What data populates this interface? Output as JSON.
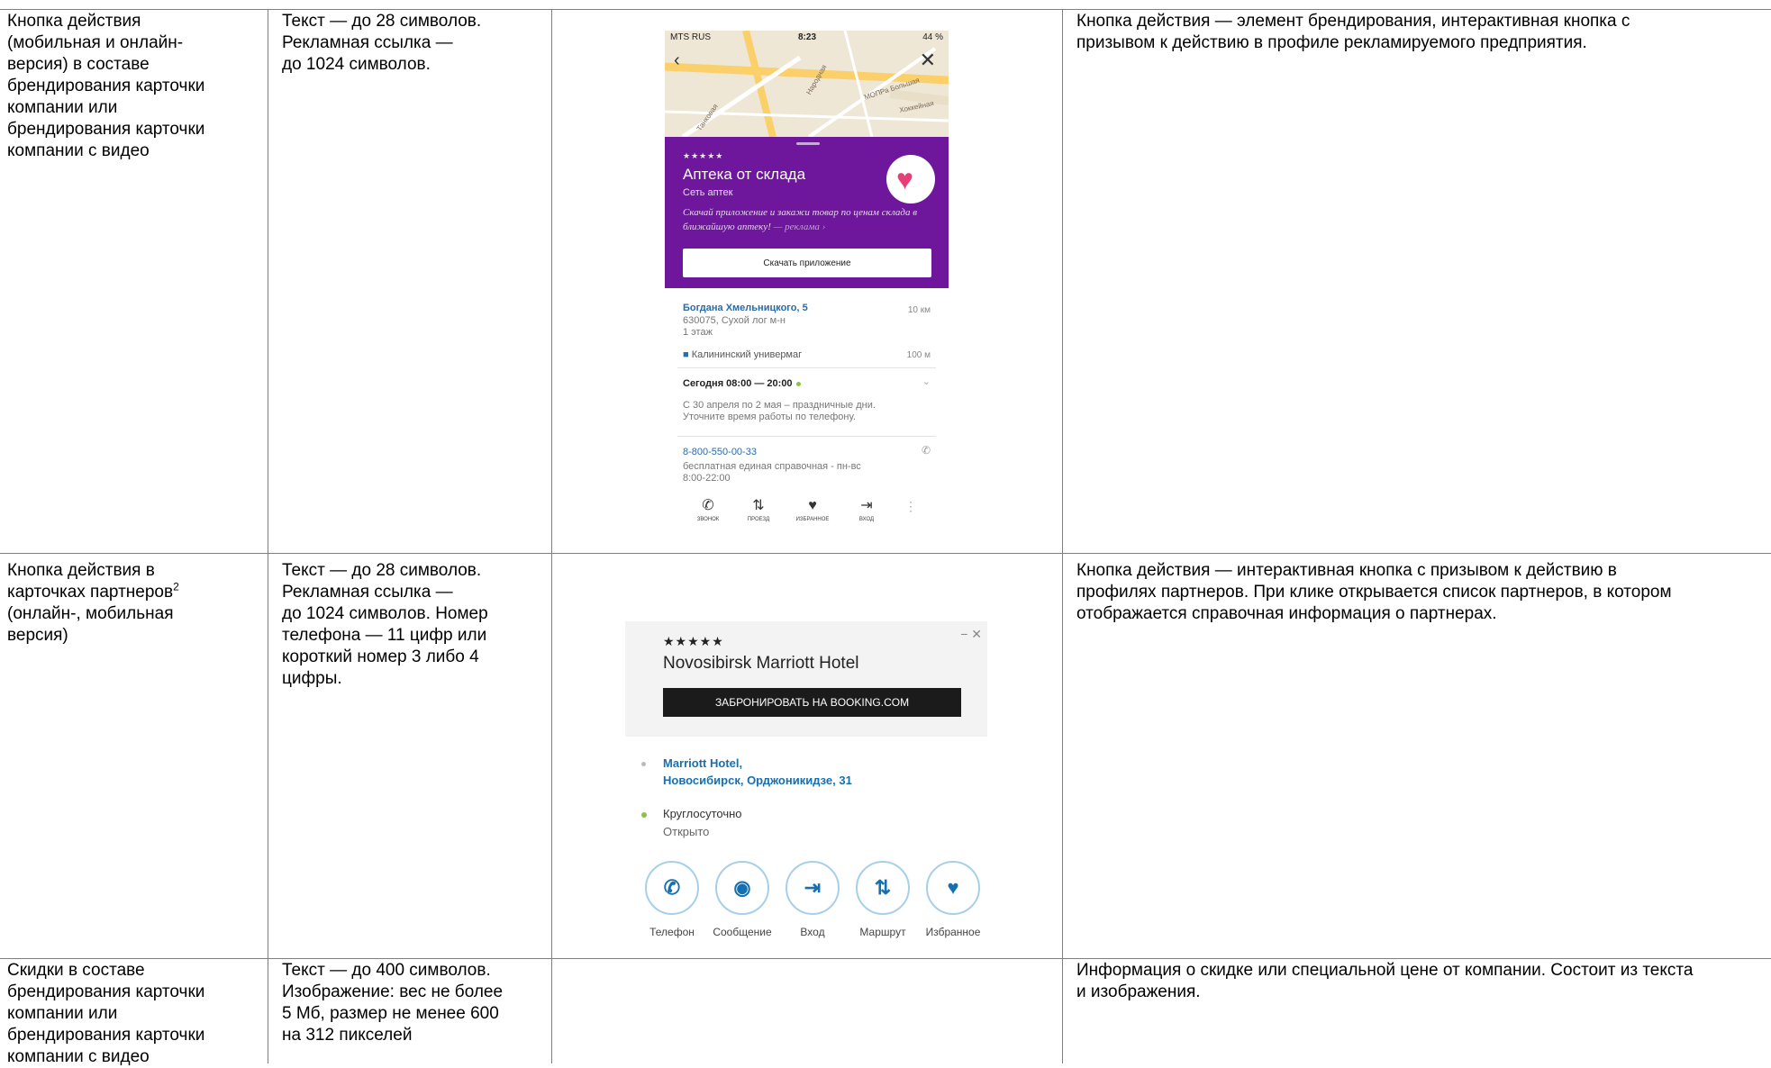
{
  "rows": [
    {
      "name": "Кнопка действия\n(мобильная и онлайн-\nверсия) в составе\nбрендирования карточки\nкомпании или\nбрендирования карточки\nкомпании с видео",
      "requirements": "Текст — до 28 символов.\nРекламная ссылка —\nдо 1024 символов.",
      "description": "Кнопка действия — элемент брендирования, интерактивная кнопка с\nпризывом к действию в профиле рекламируемого предприятия."
    },
    {
      "name_main": "Кнопка действия в\nкарточках партнеров",
      "name_sup": "2",
      "name_tail": "\n(онлайн-, мобильная\nверсия)",
      "requirements": "Текст — до 28 символов.\nРекламная ссылка —\nдо 1024 символов. Номер\nтелефона — 11 цифр или\nкороткий номер 3 либо 4\nцифры.",
      "description": "Кнопка действия — интерактивная кнопка с призывом к действию в\nпрофилях партнеров. При клике открывается список партнеров, в котором\nотображается справочная информация о партнерах."
    },
    {
      "name": "Скидки в составе\nбрендирования карточки\nкомпании или\nбрендирования карточки\nкомпании с видео",
      "requirements": "Текст — до 400 символов.\nИзображение: вес не более\n5 Мб, размер не менее 600\nна 312 пикселей",
      "description": "Информация о скидке или специальной цене от компании. Состоит из текста\nи изображения."
    }
  ],
  "phone_mock": {
    "status": {
      "carrier": "MTS RUS",
      "time": "8:23",
      "battery": "44 %"
    },
    "map_labels": [
      "Танковая",
      "МОПРа Большая",
      "Хоккейная",
      "Народная"
    ],
    "rating_stars": "★★★★★",
    "title": "Аптека от склада",
    "subtitle": "Сеть аптек",
    "promo": "Скачай приложение и закажи товар по ценам склада в ближайшую аптеку!",
    "promo_ad": "— реклама ›",
    "button": "Скачать приложение",
    "address": "Богдана Хмельницкого, 5",
    "distance": "10 км",
    "address_detail": "630075, Сухой лог м-н\n1 этаж",
    "metro": "Калининский универмаг",
    "metro_distance": "100 м",
    "hours": "Сегодня 08:00 — 20:00",
    "holiday_note": "С 30 апреля по 2 мая – праздничные дни.\nУточните время работы по телефону.",
    "phone": "8-800-550-00-33",
    "phone_note": "бесплатная единая справочная - пн-вс\n8:00-22:00",
    "bottom_bar": [
      "ЗВОНОК",
      "ПРОЕЗД",
      "ИЗБРАННОЕ",
      "ВХОД"
    ]
  },
  "hotel_mock": {
    "stars": "★★★★★",
    "name": "Novosibirsk Marriott Hotel",
    "button": "ЗАБРОНИРОВАТЬ НА BOOKING.COM",
    "address": "Marriott Hotel,\nНовосибирск, Орджоникидзе, 31",
    "hours": "Круглосуточно",
    "status": "Открыто",
    "actions": [
      "Телефон",
      "Сообщение",
      "Вход",
      "Маршрут",
      "Избранное"
    ]
  },
  "colors": {
    "brand_purple": "#6e179c",
    "link_blue": "#1670b0",
    "open_green": "#8bc34a",
    "heart_pink": "#e83e74"
  }
}
